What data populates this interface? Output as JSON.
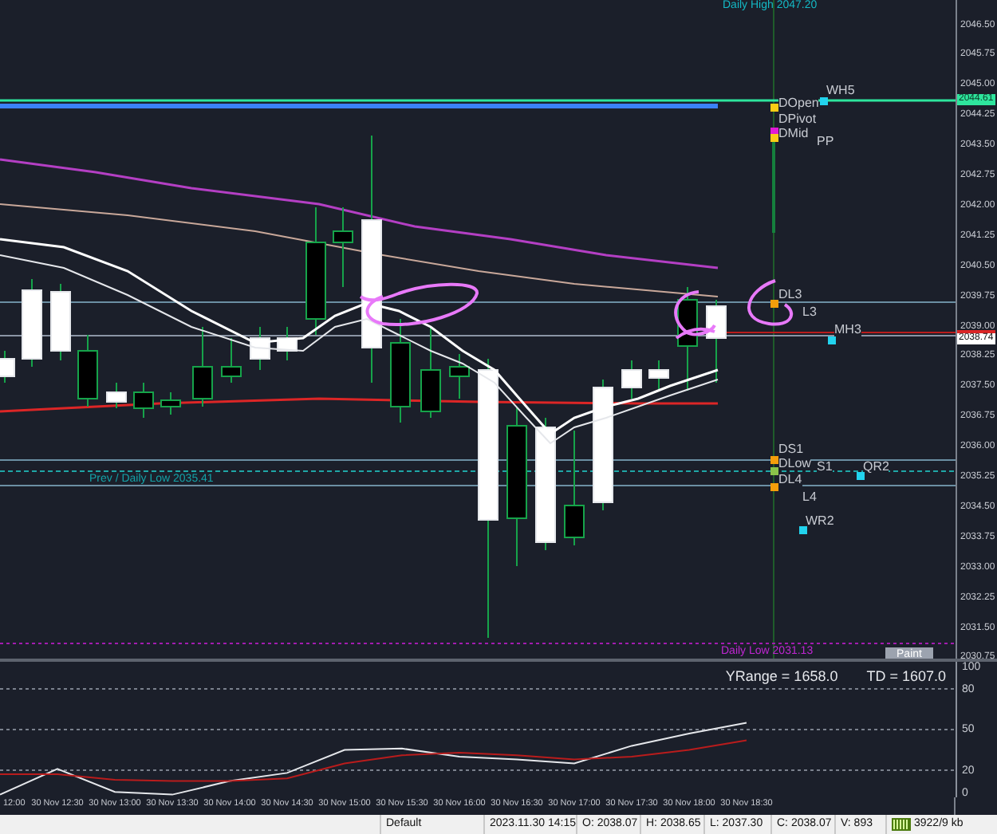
{
  "chart": {
    "daily_high": "Daily High 2047.20",
    "prev_daily_low": "Prev / Daily Low 2035.41",
    "daily_low": "Daily Low 2031.13",
    "paint_button": "Paint",
    "markers": [
      {
        "kind": "dot",
        "label": "WH5",
        "color": "#22d3ee"
      },
      {
        "kind": "dot",
        "label": "DOpen",
        "color": "#facc15"
      },
      {
        "kind": "dot",
        "label": "DPivot",
        "color": "#e11ad5"
      },
      {
        "kind": "dot",
        "label": "DMid",
        "color": "#facc15"
      },
      {
        "kind": "plain",
        "label": "PP"
      },
      {
        "kind": "dot",
        "label": "DL3",
        "color": "#f59e0b"
      },
      {
        "kind": "plain",
        "label": "L3"
      },
      {
        "kind": "dot",
        "label": "MH3",
        "color": "#22d3ee"
      },
      {
        "kind": "dot",
        "label": "DS1",
        "color": "#f59e0b"
      },
      {
        "kind": "dot",
        "label": "DLow",
        "color": "#8bc34a"
      },
      {
        "kind": "plain",
        "label": "S1"
      },
      {
        "kind": "dot",
        "label": "QR2",
        "color": "#22d3ee"
      },
      {
        "kind": "dot",
        "label": "DL4",
        "color": "#f59e0b"
      },
      {
        "kind": "plain",
        "label": "L4"
      },
      {
        "kind": "dot",
        "label": "WR2",
        "color": "#22d3ee"
      }
    ]
  },
  "price_axis": {
    "labels": [
      "2046.50",
      "2045.75",
      "2045.00",
      "2044.25",
      "2043.50",
      "2042.75",
      "2042.00",
      "2041.25",
      "2040.50",
      "2039.75",
      "2039.00",
      "2038.25",
      "2037.50",
      "2036.75",
      "2036.00",
      "2035.25",
      "2034.50",
      "2033.75",
      "2033.00",
      "2032.25",
      "2031.50",
      "2030.75"
    ],
    "level_price": "2044.61",
    "current_price": "2038.74"
  },
  "oscillator": {
    "yrange": "YRange = 1658.0",
    "td": "TD = 1607.0",
    "chart_data": {
      "type": "line",
      "categories": [
        "12:00",
        "30 Nov 12:30",
        "30 Nov 13:00",
        "30 Nov 13:30",
        "30 Nov 14:00",
        "30 Nov 14:30",
        "30 Nov 15:00",
        "30 Nov 15:30",
        "30 Nov 16:00",
        "30 Nov 16:30",
        "30 Nov 17:00",
        "30 Nov 17:30",
        "30 Nov 18:00",
        "30 Nov 18:30"
      ],
      "series": [
        {
          "color": "#e5e7eb",
          "values": [
            2,
            21,
            4,
            2,
            12,
            18,
            35,
            36,
            30,
            28,
            25,
            38,
            47,
            55
          ]
        },
        {
          "color": "#b91c1c",
          "values": [
            17,
            17,
            13,
            12,
            12,
            14,
            25,
            31,
            33,
            31,
            28,
            30,
            35,
            42
          ]
        }
      ],
      "grid": true,
      "ylim": [
        0,
        100
      ],
      "yticks": [
        0,
        20,
        50,
        80,
        100
      ]
    }
  },
  "status_bar": {
    "profile": "Default",
    "datetime": "2023.11.30 14:15",
    "open": "O: 2038.07",
    "high": "H: 2038.65",
    "low": "L: 2037.30",
    "close": "C: 2038.07",
    "volume": "V: 893",
    "traffic": "3922/9 kb"
  }
}
